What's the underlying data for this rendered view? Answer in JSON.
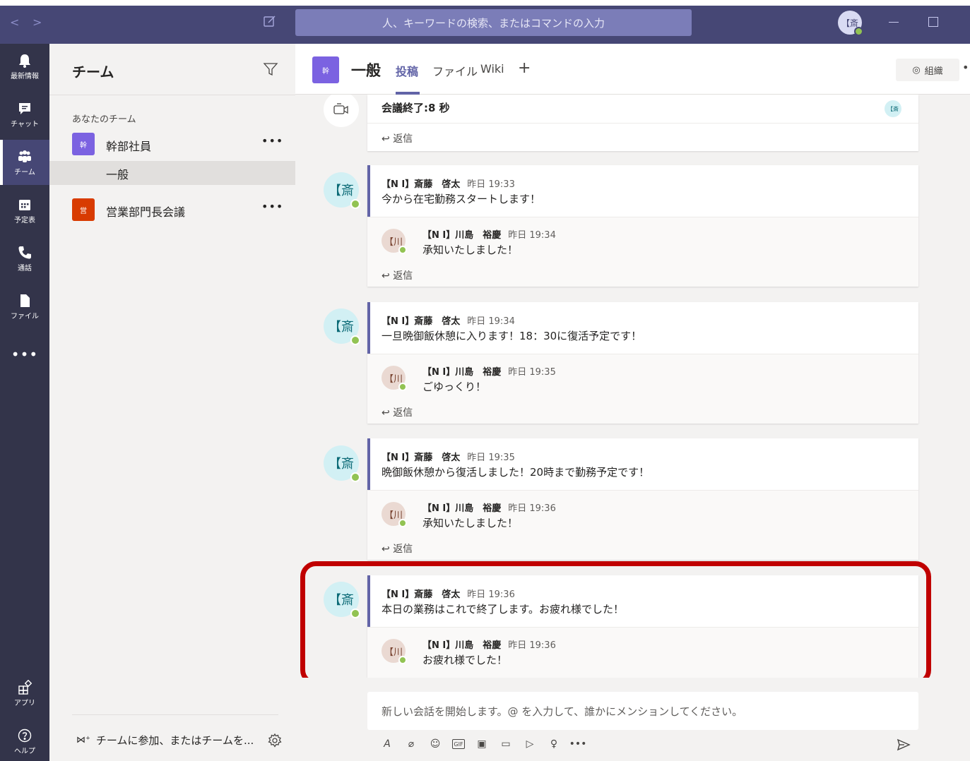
{
  "window": {
    "search_placeholder": "人、キーワードの検索、またはコマンドの入力",
    "profile_initial": "【斎"
  },
  "rail": {
    "items": [
      {
        "label": "最新情報",
        "icon": "bell-icon"
      },
      {
        "label": "チャット",
        "icon": "chat-icon"
      },
      {
        "label": "チーム",
        "icon": "teams-icon",
        "active": true
      },
      {
        "label": "予定表",
        "icon": "calendar-icon"
      },
      {
        "label": "通話",
        "icon": "phone-icon"
      },
      {
        "label": "ファイル",
        "icon": "file-icon"
      }
    ],
    "more": "•••",
    "apps_label": "アプリ",
    "help_label": "ヘルプ"
  },
  "teams_panel": {
    "title": "チーム",
    "your_teams_label": "あなたのチーム",
    "teams": [
      {
        "tile_text": "幹",
        "name": "幹部社員",
        "color": "#7b62e1",
        "more": "•••",
        "channels": [
          "一般"
        ]
      },
      {
        "tile_text": "営",
        "name": "営業部門長会議",
        "color": "#d83b01",
        "more": "•••"
      }
    ],
    "join_label": "チームに参加、またはチームを..."
  },
  "channel": {
    "tile_text": "幹",
    "name": "一般",
    "tabs": [
      "投稿",
      "ファイル",
      "Wiki"
    ],
    "active_tab": "投稿",
    "add_tab": "+",
    "org_label": "組織",
    "more": "••"
  },
  "meeting": {
    "text": "会議終了:8 秒",
    "mini_avatar": "【斎",
    "reply_label": "返信"
  },
  "threads": [
    {
      "author": "【N I】斎藤　啓太",
      "time": "昨日 19:33",
      "initial": "【斎",
      "body": "今から在宅勤務スタートします！",
      "reply": {
        "author": "【N I】川島　裕慶",
        "time": "昨日 19:34",
        "initial": "【川",
        "body": "承知いたしました！"
      },
      "reply_label": "返信"
    },
    {
      "author": "【N I】斎藤　啓太",
      "time": "昨日 19:34",
      "initial": "【斎",
      "body": "一旦晩御飯休憩に入ります！18：30に復活予定です！",
      "reply": {
        "author": "【N I】川島　裕慶",
        "time": "昨日 19:35",
        "initial": "【川",
        "body": "ごゆっくり！"
      },
      "reply_label": "返信"
    },
    {
      "author": "【N I】斎藤　啓太",
      "time": "昨日 19:35",
      "initial": "【斎",
      "body": "晩御飯休憩から復活しました！20時まで勤務予定です！",
      "reply": {
        "author": "【N I】川島　裕慶",
        "time": "昨日 19:36",
        "initial": "【川",
        "body": "承知いたしました！"
      },
      "reply_label": "返信"
    },
    {
      "author": "【N I】斎藤　啓太",
      "time": "昨日 19:36",
      "initial": "【斎",
      "body": "本日の業務はこれで終了します。お疲れ様でした！",
      "reply": {
        "author": "【N I】川島　裕慶",
        "time": "昨日 19:36",
        "initial": "【川",
        "body": "お疲れ様でした！"
      }
    }
  ],
  "compose": {
    "placeholder": "新しい会話を開始します。@ を入力して、誰かにメンションしてください。",
    "tools": [
      "format-icon",
      "attach-icon",
      "emoji-icon",
      "gif-icon",
      "sticker-icon",
      "meet-now-icon",
      "stream-icon",
      "praise-icon",
      "more-icon"
    ]
  },
  "colors": {
    "titlebar": "#464775",
    "rail": "#33344a",
    "accent": "#6264a7",
    "highlight": "#c00000",
    "presence": "#92c353"
  }
}
